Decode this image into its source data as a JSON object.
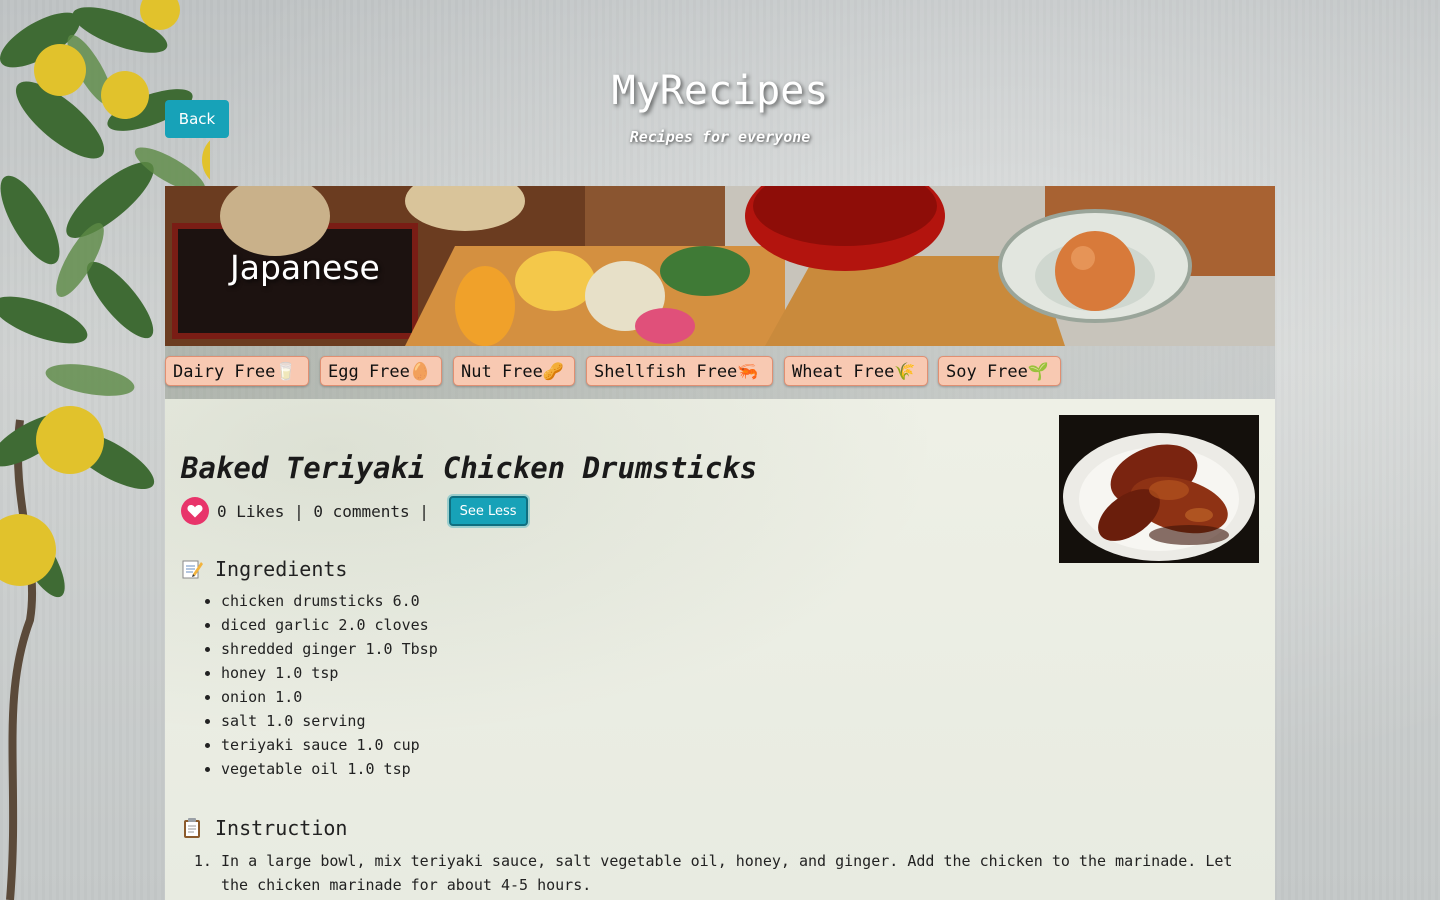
{
  "header": {
    "site_title": "MyRecipes",
    "site_subtitle": "Recipes for everyone",
    "back_label": "Back"
  },
  "banner": {
    "cuisine": "Japanese"
  },
  "tags": [
    {
      "label": "Dairy Free🥛"
    },
    {
      "label": "Egg Free🥚"
    },
    {
      "label": "Nut Free🥜"
    },
    {
      "label": "Shellfish Free🦐"
    },
    {
      "label": "Wheat Free🌾"
    },
    {
      "label": "Soy Free🌱"
    }
  ],
  "recipe": {
    "title": "Baked Teriyaki Chicken Drumsticks",
    "likes_text": "0 Likes",
    "separator": " | ",
    "comments_text": "0 comments",
    "see_less_label": "See Less",
    "ingredients_heading": "Ingredients",
    "ingredients": [
      "chicken drumsticks 6.0",
      "diced garlic 2.0 cloves",
      "shredded ginger 1.0 Tbsp",
      "honey 1.0 tsp",
      "onion 1.0",
      "salt 1.0 serving",
      "teriyaki sauce 1.0 cup",
      "vegetable oil 1.0 tsp"
    ],
    "instruction_heading": "Instruction",
    "instructions": [
      "In a large bowl, mix teriyaki sauce, salt vegetable oil, honey, and ginger. Add the chicken to the marinade. Let the chicken marinade for about 4-5 hours."
    ]
  },
  "colors": {
    "accent": "#17a2b8",
    "heart": "#e8346a",
    "tag_bg": "#f8c9b2",
    "tag_border": "#e08f72"
  },
  "icons": {
    "heart": "heart-icon",
    "ingredients": "memo-icon",
    "instruction": "clipboard-icon"
  }
}
